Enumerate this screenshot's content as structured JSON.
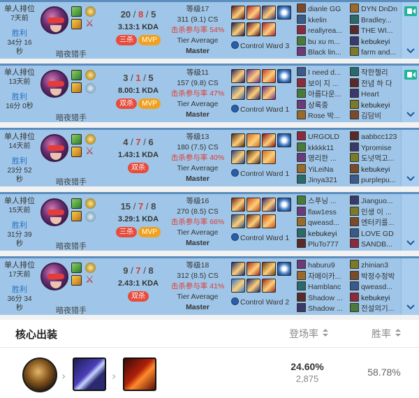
{
  "matches": [
    {
      "queue": "单人排位",
      "ago": "7天前",
      "result": "胜利",
      "duration": "34分 16秒",
      "champion": "暗夜猎手",
      "kills": "20",
      "deaths": "8",
      "assists": "5",
      "kda": "3.13:1 KDA",
      "badges": [
        "三杀",
        "MVP"
      ],
      "level": "等级17",
      "cs": "311 (9.1) CS",
      "kp": "击杀参与率 54%",
      "tier_label": "Tier Average",
      "tier": "Master",
      "ward": "Control Ward 3",
      "team_left": [
        "dianle GG",
        "kkelin",
        "reallyrea...",
        "bu xu m...",
        "Black lin..."
      ],
      "team_right": [
        "DYN DnDn",
        "Bradley...",
        "THE WI...",
        "kebukeyi",
        "farm and..."
      ],
      "video": true
    },
    {
      "queue": "单人排位",
      "ago": "13天前",
      "result": "胜利",
      "duration": "16分 0秒",
      "champion": "暗夜猎手",
      "kills": "3",
      "deaths": "1",
      "assists": "5",
      "kda": "8.00:1 KDA",
      "badges": [
        "双杀",
        "MVP"
      ],
      "level": "等级11",
      "cs": "157 (9.8) CS",
      "kp": "击杀参与率 47%",
      "tier_label": "Tier Average",
      "tier": "Master",
      "ward": "Control Ward 1",
      "team_left": [
        "I need d...",
        "보이 지 ...",
        "아름다운...",
        "상록중",
        "Rose 박..."
      ],
      "team_right": [
        "작한첼리",
        "전념 하 다",
        "Heart",
        "kebukeyi",
        "김담비"
      ],
      "video": true
    },
    {
      "queue": "单人排位",
      "ago": "14天前",
      "result": "胜利",
      "duration": "23分 52秒",
      "champion": "暗夜猎手",
      "kills": "4",
      "deaths": "7",
      "assists": "6",
      "kda": "1.43:1 KDA",
      "badges": [
        "双杀"
      ],
      "level": "等级13",
      "cs": "180 (7.5) CS",
      "kp": "击杀参与率 40%",
      "tier_label": "Tier Average",
      "tier": "Master",
      "ward": "Control Ward 1",
      "team_left": [
        "URGOLD",
        "kkkkk11",
        "영리한 ...",
        "YiLeiNa",
        "Jinya321"
      ],
      "team_right": [
        "aabbcc123",
        "Ypromise",
        "도넛먹고...",
        "kebukeyi",
        "purplepu..."
      ],
      "video": false
    },
    {
      "queue": "单人排位",
      "ago": "15天前",
      "result": "胜利",
      "duration": "31分 39秒",
      "champion": "暗夜猎手",
      "kills": "15",
      "deaths": "7",
      "assists": "8",
      "kda": "3.29:1 KDA",
      "badges": [
        "三杀",
        "MVP"
      ],
      "level": "等级16",
      "cs": "270 (8.5) CS",
      "kp": "击杀参与率 66%",
      "tier_label": "Tier Average",
      "tier": "Master",
      "ward": "Control Ward 1",
      "team_left": [
        "스푸닝 ...",
        "flaw1ess",
        "qweasd...",
        "kebukeyi",
        "PluTo777"
      ],
      "team_right": [
        "Jianguo...",
        "인생 이 ...",
        "엔터키를...",
        "LOVE GD",
        "SANDB..."
      ],
      "video": false
    },
    {
      "queue": "单人排位",
      "ago": "17天前",
      "result": "胜利",
      "duration": "36分 34秒",
      "champion": "暗夜猎手",
      "kills": "9",
      "deaths": "7",
      "assists": "8",
      "kda": "2.43:1 KDA",
      "badges": [
        "双杀"
      ],
      "level": "等级18",
      "cs": "312 (8.5) CS",
      "kp": "击杀参与率 41%",
      "tier_label": "Tier Average",
      "tier": "Master",
      "ward": "Control Ward 2",
      "team_left": [
        "haburu9",
        "자메이카...",
        "Hamblanc",
        "Shadow ...",
        "Shadow ..."
      ],
      "team_right": [
        "zhinian3",
        "박정수정박",
        "qweasd...",
        "kebukeyi",
        "전설의기..."
      ],
      "video": false
    }
  ],
  "core_build": {
    "title": "核心出装",
    "col_pick": "登场率",
    "col_win": "胜率",
    "pick_rate": "24.60%",
    "pick_count": "2,875",
    "win_rate": "58.78%"
  },
  "colors": {
    "row_bg": "#9fc6e8",
    "row_border": "#5a8dbd",
    "deaths_red": "#e0392e",
    "badge_multi": "#e74c3c",
    "badge_mvp": "#f0a11e",
    "win_blue": "#2a6fc0",
    "video_green": "#20b39b"
  }
}
